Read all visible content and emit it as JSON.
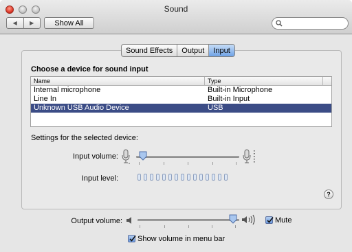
{
  "window": {
    "title": "Sound"
  },
  "toolbar": {
    "back_label": "◀",
    "forward_label": "▶",
    "show_all_label": "Show All",
    "search_placeholder": ""
  },
  "tabs": [
    {
      "label": "Sound Effects",
      "selected": false
    },
    {
      "label": "Output",
      "selected": false
    },
    {
      "label": "Input",
      "selected": true
    }
  ],
  "input": {
    "heading": "Choose a device for sound input",
    "columns": [
      "Name",
      "Type"
    ],
    "devices": [
      {
        "name": "Internal microphone",
        "type": "Built-in Microphone",
        "selected": false
      },
      {
        "name": "Line In",
        "type": "Built-in Input",
        "selected": false
      },
      {
        "name": "Unknown USB Audio Device",
        "type": "USB",
        "selected": true
      }
    ],
    "settings_label": "Settings for the selected device:",
    "volume_label": "Input volume:",
    "volume_value": 0.05,
    "level_label": "Input level:",
    "level_segments": 15
  },
  "output": {
    "volume_label": "Output volume:",
    "volume_value": 0.94,
    "mute_label": "Mute",
    "mute_checked": true,
    "menubar_label": "Show volume in menu bar",
    "menubar_checked": true
  },
  "help_label": "?",
  "colors": {
    "selection": "#3b4c86",
    "accent": "#6ea2e6"
  }
}
